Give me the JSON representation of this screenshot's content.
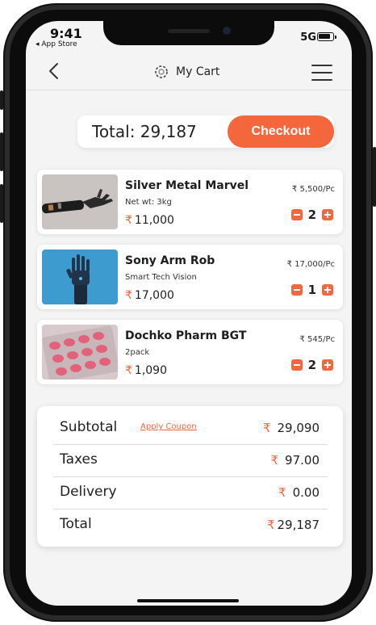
{
  "status_bar": {
    "time": "9:41",
    "back_label": "◂ App Store",
    "network": "5G"
  },
  "header": {
    "title": "My Cart",
    "icons": {
      "back": "chevron-left-icon",
      "logo": "cart-logo-icon",
      "menu": "hamburger-menu-icon"
    }
  },
  "total_bar": {
    "label": "Total: 29,187",
    "checkout_label": "Checkout"
  },
  "currency_symbol": "₹",
  "items": [
    {
      "name": "Silver Metal Marvel",
      "subtitle": "Net wt: 3kg",
      "total": "11,000",
      "unit_price": "₹ 5,500/Pc",
      "quantity": "2"
    },
    {
      "name": "Sony Arm Rob",
      "subtitle": "Smart Tech Vision",
      "total": "17,000",
      "unit_price": "₹ 17,000/Pc",
      "quantity": "1"
    },
    {
      "name": "Dochko Pharm BGT",
      "subtitle": "2pack",
      "total": "1,090",
      "unit_price": "₹ 545/Pc",
      "quantity": "2"
    }
  ],
  "summary": {
    "subtotal_label": "Subtotal",
    "coupon_label": "Apply Coupon",
    "subtotal_value": "29,090",
    "taxes_label": "Taxes",
    "taxes_value": "97.00",
    "delivery_label": "Delivery",
    "delivery_value": "0.00",
    "total_label": "Total",
    "total_value": "29,187"
  },
  "colors": {
    "accent": "#f4663c",
    "background": "#f4f4f4",
    "card": "#ffffff",
    "text": "#1e1e1e"
  }
}
